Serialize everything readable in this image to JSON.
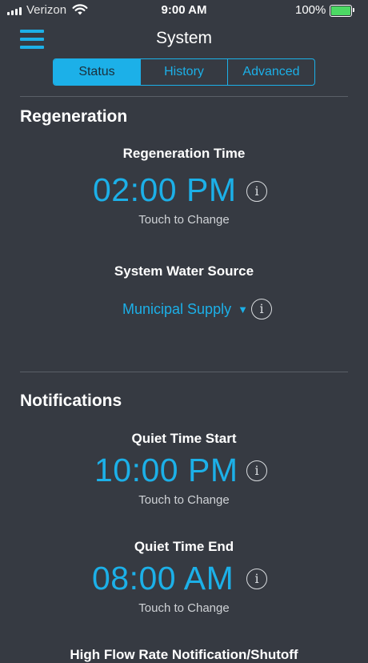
{
  "status_bar": {
    "carrier": "Verizon",
    "time": "9:00 AM",
    "battery_percent": "100%",
    "battery_level": 1.0,
    "battery_color": "#4cd964"
  },
  "header": {
    "title": "System",
    "menu_icon": "hamburger-menu-icon"
  },
  "tabs": [
    {
      "label": "Status",
      "active": true
    },
    {
      "label": "History",
      "active": false
    },
    {
      "label": "Advanced",
      "active": false
    }
  ],
  "regeneration": {
    "section_title": "Regeneration",
    "time_label": "Regeneration Time",
    "time_value": "02:00 PM",
    "time_hint": "Touch to Change",
    "water_source_label": "System Water Source",
    "water_source_value": "Municipal Supply",
    "dropdown_icon": "caret-down-icon"
  },
  "notifications": {
    "section_title": "Notifications",
    "quiet_start_label": "Quiet Time Start",
    "quiet_start_value": "10:00 PM",
    "quiet_start_hint": "Touch to Change",
    "quiet_end_label": "Quiet Time End",
    "quiet_end_value": "08:00 AM",
    "quiet_end_hint": "Touch to Change",
    "high_flow_label": "High Flow Rate Notification/Shutoff"
  },
  "colors": {
    "accent": "#1cb0e8",
    "background": "#363a42",
    "text": "#ffffff",
    "hint_text": "#cfd2d6",
    "divider": "#5a5f67"
  }
}
